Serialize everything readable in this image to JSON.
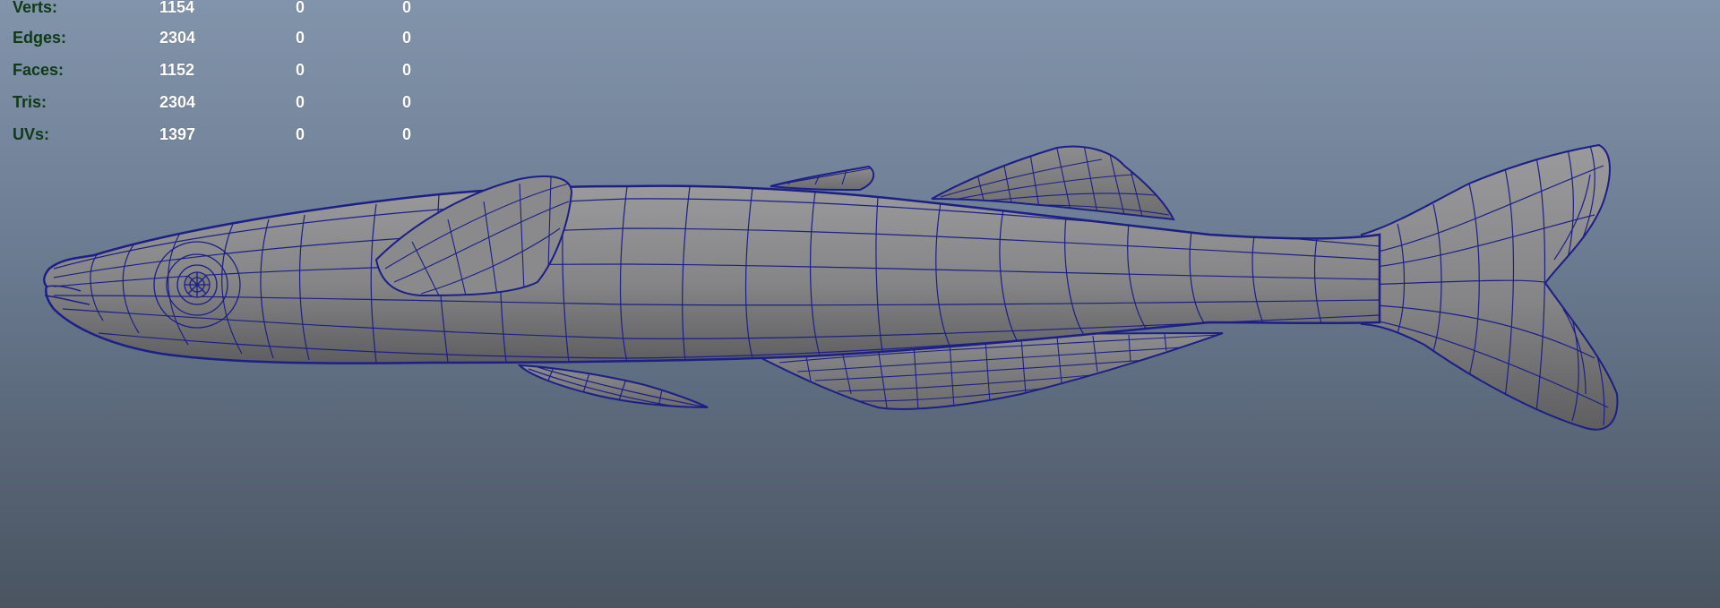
{
  "viewport": {
    "background_top": "#8294ab",
    "background_bottom": "#4a5461",
    "wire_color": "#1c1f86",
    "mesh_fill": "#8a8a8c",
    "model": "fish-mesh"
  },
  "hud": {
    "label_color": "#103a16",
    "value_color": "#ffffff",
    "rows": [
      {
        "label": "Verts:",
        "v1": "1154",
        "v2": "0",
        "v3": "0"
      },
      {
        "label": "Edges:",
        "v1": "2304",
        "v2": "0",
        "v3": "0"
      },
      {
        "label": "Faces:",
        "v1": "1152",
        "v2": "0",
        "v3": "0"
      },
      {
        "label": "Tris:",
        "v1": "2304",
        "v2": "0",
        "v3": "0"
      },
      {
        "label": "UVs:",
        "v1": "1397",
        "v2": "0",
        "v3": "0"
      }
    ]
  }
}
